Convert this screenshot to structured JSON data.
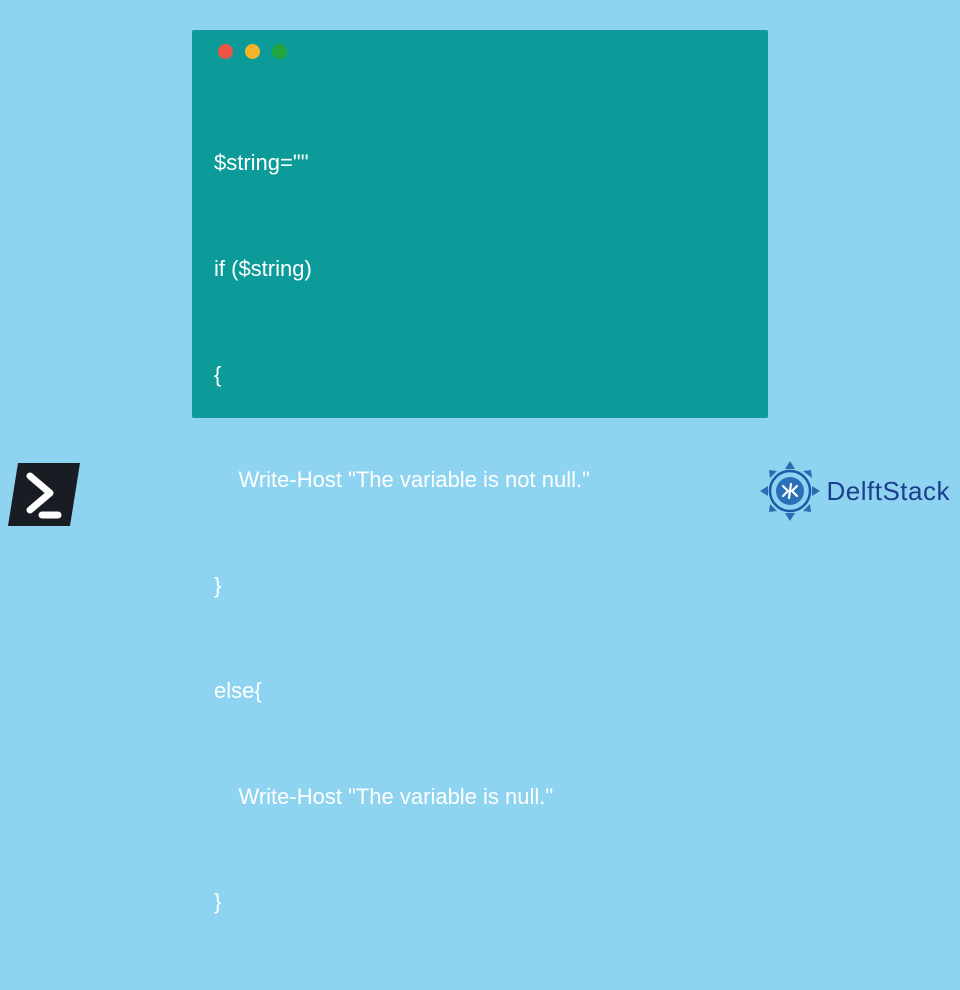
{
  "code": {
    "lines": [
      "$string=\"\"",
      "if ($string)",
      "{",
      "    Write-Host \"The variable is not null.\"",
      "}",
      "else{",
      "    Write-Host \"The variable is null.\"",
      "}"
    ]
  },
  "brand": {
    "name": "DelftStack"
  }
}
